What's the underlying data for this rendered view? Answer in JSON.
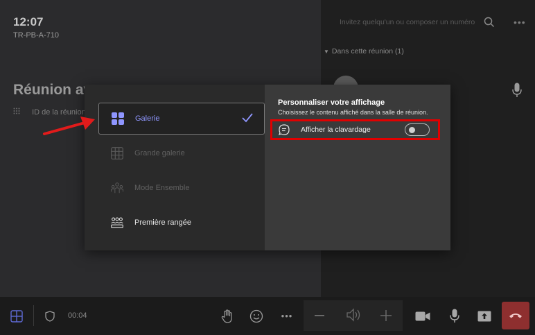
{
  "meeting": {
    "time": "12:07",
    "room": "TR-PB-A-710",
    "title": "Réunion av",
    "id_label": "ID de la réunion"
  },
  "participants": {
    "invite_placeholder": "Invitez quelqu'un ou composer un numéro",
    "section_label": "Dans cette réunion (1)"
  },
  "toolbar": {
    "timer": "00:04",
    "end_call_color": "#8e2f2f"
  },
  "view_options": {
    "items": [
      {
        "label": "Galerie",
        "state": "selected",
        "icon": "gallery-icon"
      },
      {
        "label": "Grande galerie",
        "state": "disabled",
        "icon": "large-gallery-icon"
      },
      {
        "label": "Mode Ensemble",
        "state": "disabled",
        "icon": "together-mode-icon"
      },
      {
        "label": "Première rangée",
        "state": "enabled",
        "icon": "front-row-icon"
      }
    ],
    "accent_color": "#8f96ff"
  },
  "customize": {
    "title": "Personnaliser votre affichage",
    "subtitle": "Choisissez le contenu affiché dans la salle de réunion.",
    "chat_label": "Afficher la clavardage",
    "chat_enabled": false,
    "highlight_color": "#e10000"
  }
}
